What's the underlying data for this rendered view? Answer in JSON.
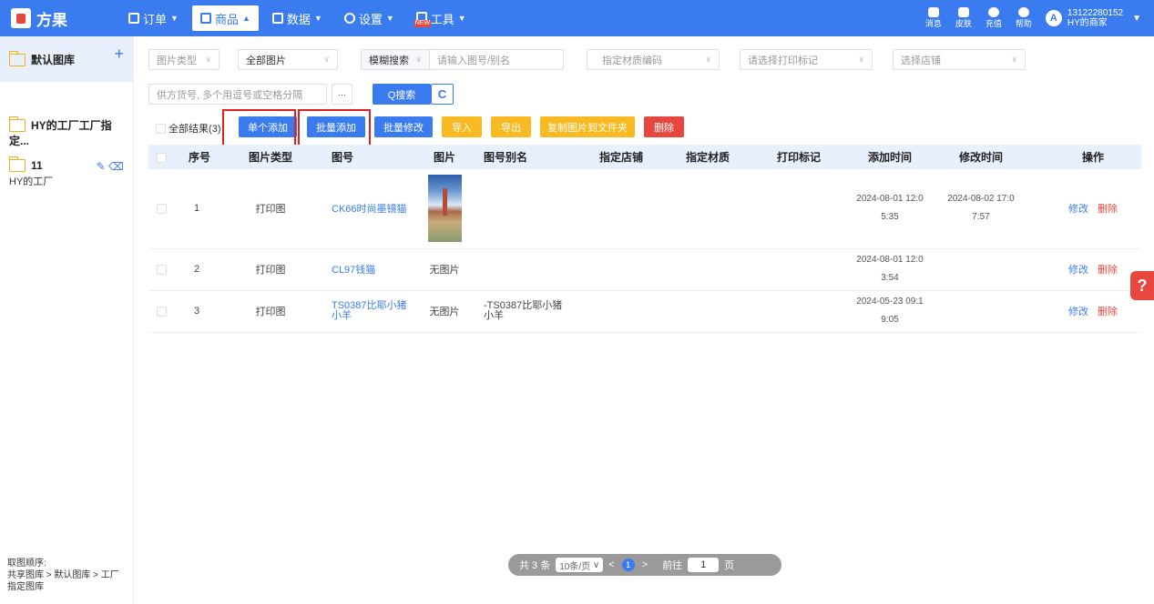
{
  "app": {
    "title": "方果"
  },
  "nav": [
    {
      "label": "订单",
      "icon": "list-icon",
      "active": false
    },
    {
      "label": "商品",
      "icon": "product-icon",
      "active": true
    },
    {
      "label": "数据",
      "icon": "chart-icon",
      "active": false
    },
    {
      "label": "设置",
      "icon": "gear-icon",
      "active": false
    },
    {
      "label": "工具",
      "icon": "toolbox-icon",
      "active": false,
      "badge": "NEW"
    }
  ],
  "header_icons": [
    {
      "label": "消息",
      "icon": "message-icon"
    },
    {
      "label": "皮肤",
      "icon": "shirt-icon"
    },
    {
      "label": "充值",
      "icon": "recharge-icon"
    },
    {
      "label": "帮助",
      "icon": "help-icon"
    }
  ],
  "user": {
    "avatar": "A",
    "phone": "13122280152",
    "name": "HY的商家"
  },
  "sidebar": {
    "items": [
      {
        "label": "默认图库",
        "sub": ""
      },
      {
        "label": "HY的工厂工厂指定...",
        "sub": ""
      },
      {
        "label": "11",
        "sub": "HY的工厂"
      }
    ],
    "add_symbol": "+",
    "footer_title": "取图顺序:",
    "footer_line1": "共享图库 > 默认图库 > 工厂",
    "footer_line2": "指定图库"
  },
  "filters": {
    "image_type": "图片类型",
    "all_images": "全部图片",
    "search_mode": "模糊搜索",
    "image_no_placeholder": "请输入图号/别名",
    "material_code": "指定材质编码",
    "print_mark": "请选择打印标记",
    "store": "选择店铺",
    "supplier_placeholder": "供方货号, 多个用逗号或空格分隔",
    "more": "···",
    "search_btn": "Q搜索",
    "refresh": "C"
  },
  "actions": {
    "all_results": "全部结果(3)",
    "single_add": "单个添加",
    "batch_add": "批量添加",
    "batch_edit": "批量修改",
    "import": "导入",
    "export": "导出",
    "copy_to_folder": "复制图片到文件夹",
    "delete": "删除"
  },
  "table": {
    "headers": [
      "序号",
      "图片类型",
      "图号",
      "图片",
      "图号别名",
      "指定店铺",
      "指定材质",
      "打印标记",
      "添加时间",
      "修改时间",
      "操作"
    ],
    "rows": [
      {
        "no": "1",
        "type": "打印图",
        "code": "CK66时尚墨镜猫",
        "image": "",
        "alias": "",
        "store": "",
        "material": "",
        "mark": "",
        "added_1": "2024-08-01 12:0",
        "added_2": "5:35",
        "modified_1": "2024-08-02 17:0",
        "modified_2": "7:57",
        "edit": "修改",
        "del": "删除"
      },
      {
        "no": "2",
        "type": "打印图",
        "code": "CL97钱猫",
        "image": "无图片",
        "alias": "",
        "store": "",
        "material": "",
        "mark": "",
        "added_1": "2024-08-01 12:0",
        "added_2": "3:54",
        "modified_1": "",
        "modified_2": "",
        "edit": "修改",
        "del": "删除"
      },
      {
        "no": "3",
        "type": "打印图",
        "code_1": "TS0387比耶小猪",
        "code_2": "小羊",
        "image": "无图片",
        "alias_1": "-TS0387比耶小猪",
        "alias_2": "小羊",
        "store": "",
        "material": "",
        "mark": "",
        "added_1": "2024-05-23 09:1",
        "added_2": "9:05",
        "modified_1": "",
        "modified_2": "",
        "edit": "修改",
        "del": "删除"
      }
    ]
  },
  "pager": {
    "total": "共 3 条",
    "page_size": "10条/页",
    "current": "1",
    "goto_label": "前往",
    "goto_value": "1",
    "page_unit": "页",
    "prev": "<",
    "next": ">"
  },
  "help_float": "?",
  "colors": {
    "primary": "#3a7cf0",
    "danger": "#e8473f",
    "warning": "#f8b921",
    "highlight_box": "#e02020"
  }
}
